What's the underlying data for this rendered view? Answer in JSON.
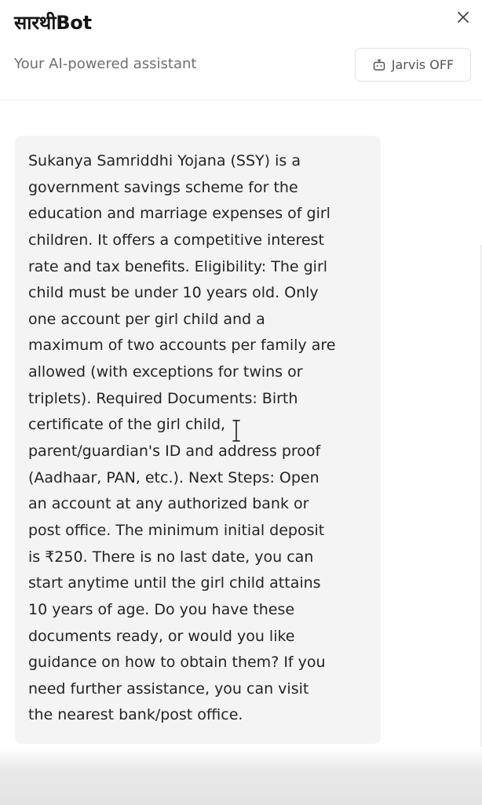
{
  "header": {
    "title": "सारथीBot",
    "subtitle": "Your AI-powered assistant",
    "jarvis_label": "Jarvis OFF",
    "jarvis_icon": "robot-icon",
    "close_icon": "close-icon"
  },
  "message": {
    "lines": [
      "Sukanya Samriddhi Yojana (SSY) is a",
      "government savings scheme for the",
      "education and marriage expenses of girl",
      "children. It offers a competitive interest",
      "rate and tax benefits. Eligibility: The girl",
      "child must be under 10 years old. Only",
      "one account per girl child and a",
      "maximum of two accounts per family are",
      "allowed (with exceptions for twins or",
      "triplets). Required Documents: Birth",
      "certificate of the girl child,",
      "parent/guardian's ID and address proof",
      "(Aadhaar, PAN, etc.). Next Steps: Open",
      "an account at any authorized bank or",
      "post office. The minimum initial deposit",
      "is ₹250. There is no last date, you can",
      "start anytime until the girl child attains",
      "10 years of age. Do you have these",
      "documents ready, or would you like",
      "guidance on how to obtain them? If you",
      "need further assistance, you can visit",
      "the nearest bank/post office."
    ]
  },
  "colors": {
    "bubble_background": "#f4f4f4",
    "subtitle_text": "#6f6f6f",
    "border": "#e1e1e1"
  }
}
